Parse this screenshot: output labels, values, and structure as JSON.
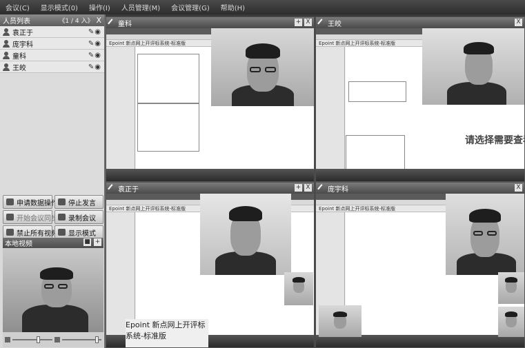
{
  "menu": {
    "items": [
      "会议(C)",
      "显示模式(0)",
      "操作(I)",
      "人员管理(M)",
      "会议管理(G)",
      "帮助(H)"
    ]
  },
  "people_list": {
    "title": "人员列表",
    "pager": "《1 / 4 入》",
    "close": "X",
    "members": [
      {
        "name": "袁正于"
      },
      {
        "name": "庞宇科"
      },
      {
        "name": "童科"
      },
      {
        "name": "王皎"
      }
    ]
  },
  "actions": {
    "apply_data": "申请数据操作",
    "stop_speaking": "停止发言",
    "start_sync": "开始会议同步",
    "record": "录制会议",
    "ban_video": "禁止所有视频",
    "display_mode": "显示模式"
  },
  "local_video": {
    "title": "本地视频"
  },
  "panes": [
    {
      "name": "童科",
      "overlay": ""
    },
    {
      "name": "王皎",
      "overlay": "请选择需要查看的"
    },
    {
      "name": "袁正于",
      "overlay": ""
    },
    {
      "name": "庞宇科",
      "overlay": ""
    }
  ],
  "screen_title": "Epoint 新点网上开评标系统-标准版",
  "pane_controls": [
    "+",
    "X"
  ],
  "colors": {
    "title_bar": "#4a4a4a",
    "panel_bg": "#d9d9d9"
  }
}
